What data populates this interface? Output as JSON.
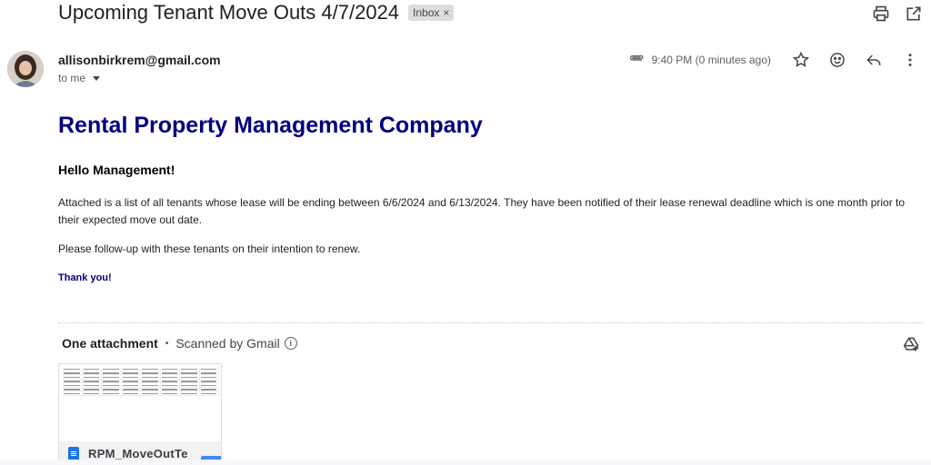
{
  "email": {
    "subject": "Upcoming Tenant Move Outs 4/7/2024",
    "label": "Inbox",
    "label_remove": "×",
    "sender": "allisonbirkrem@gmail.com",
    "recipient": "to me",
    "time": "9:40 PM (0 minutes ago)"
  },
  "body": {
    "company": "Rental Property Management Company",
    "greeting": "Hello Management!",
    "paragraph1": "Attached is a list of all tenants whose lease will be ending between 6/6/2024 and 6/13/2024. They have been notified of their lease renewal deadline which is one month prior to their expected move out date.",
    "paragraph2": "Please follow-up with these tenants on their intention to renew.",
    "signoff": "Thank you!"
  },
  "attachments": {
    "count_label": "One attachment",
    "separator": "•",
    "scan_label": "Scanned by Gmail",
    "info_glyph": "i",
    "file_name": "RPM_MoveOutTe"
  },
  "icons": {
    "print": "print-icon",
    "new_window": "open-in-new-window-icon",
    "attachment": "paperclip-icon",
    "star": "star-icon",
    "emoji": "emoji-icon",
    "reply": "reply-icon",
    "more": "more-vert-icon",
    "add_to_drive": "add-to-drive-icon",
    "file": "sheets-file-icon"
  },
  "colors": {
    "company_heading": "#000080",
    "signoff": "#000080",
    "label_chip_bg": "#dddddd",
    "file_icon": "#1a73e8"
  }
}
